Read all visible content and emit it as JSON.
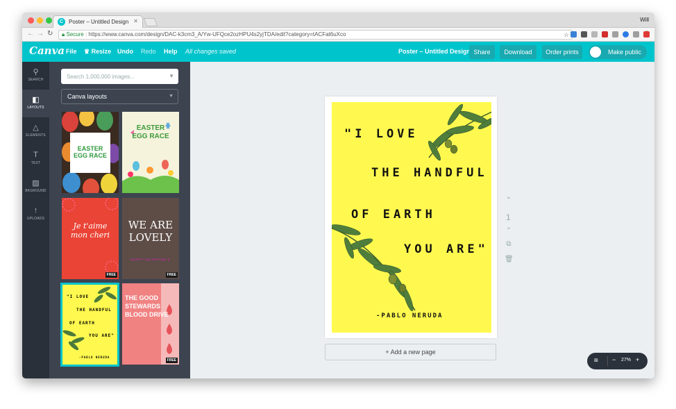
{
  "browser": {
    "tab_title": "Poster – Untitled Design",
    "user": "Will",
    "secure_label": "Secure",
    "url": "https://www.canva.com/design/DAC-k3cm3_A/Yw-UFQce2ozHPU4s2yjTDA/edit?category=tACFat6uXco"
  },
  "topbar": {
    "logo": "Canva",
    "menu": [
      "File",
      "Resize",
      "Undo",
      "Redo",
      "Help"
    ],
    "saved_status": "All changes saved",
    "design_title": "Poster – Untitled Design",
    "share": "Share",
    "download": "Download",
    "order_prints": "Order prints",
    "make_public": "Make public"
  },
  "sidenav": [
    {
      "label": "SEARCH",
      "icon": "search-icon"
    },
    {
      "label": "LAYOUTS",
      "icon": "layouts-icon"
    },
    {
      "label": "ELEMENTS",
      "icon": "elements-icon"
    },
    {
      "label": "TEXT",
      "icon": "text-icon"
    },
    {
      "label": "BKGROUND",
      "icon": "background-icon"
    },
    {
      "label": "UPLOADS",
      "icon": "upload-icon"
    }
  ],
  "panel": {
    "search_placeholder": "Search 1,000,000 images...",
    "category": "Canva layouts",
    "free_badge": "FREE",
    "templates": [
      {
        "title": "EASTER EGG RACE"
      },
      {
        "title": "EASTER EGG RACE"
      },
      {
        "title": "Je t'aime mon cheri"
      },
      {
        "title": "WE ARE LOVELY",
        "subtitle": "HAPPY VALENTINE'S"
      },
      {
        "lines": [
          "\"I LOVE",
          "THE HANDFUL",
          "OF EARTH",
          "YOU ARE\"",
          "-PABLO NERUDA"
        ]
      },
      {
        "lines": [
          "THE GOOD",
          "STEWARDS",
          "BLOOD DRIVE"
        ]
      }
    ]
  },
  "poster": {
    "lines": [
      "\"I LOVE",
      "THE HANDFUL",
      "OF EARTH",
      "YOU ARE\""
    ],
    "author": "-PABLO NERUDA",
    "background": "#fff94f"
  },
  "canvas": {
    "add_page": "+ Add a new page",
    "page_number": "1",
    "zoom": "27%"
  }
}
